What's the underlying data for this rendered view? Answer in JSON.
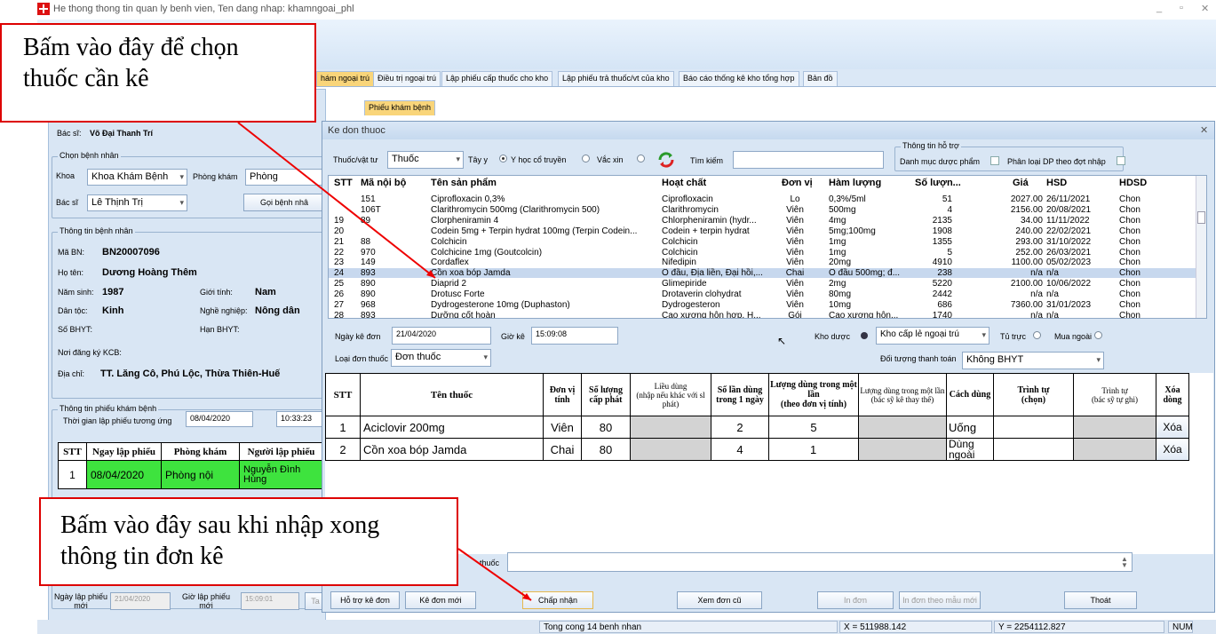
{
  "app": {
    "title": "He thong thong tin quan ly benh vien, Ten dang nhap: khamngoai_phl",
    "controls": [
      "_",
      "▫",
      "✕"
    ]
  },
  "main_tabs": [
    "hám ngoại trú",
    "Điều trị ngoại trú",
    "Lập phiếu cấp thuốc cho kho",
    "Lập phiếu trả thuốc/vt của kho",
    "Báo cáo thống kê kho tổng hợp",
    "Bản đồ"
  ],
  "sub_tab": "Phiếu khám bệnh",
  "left": {
    "bacsi_label": "Bác sĩ:",
    "bacsi": "Võ Đại Thanh Trí",
    "chon_bn": "Chọn bệnh nhân",
    "khoa_label": "Khoa",
    "khoa": "Khoa Khám Bệnh",
    "phongkham_label": "Phòng khám",
    "phongkham": "Phòng",
    "bacsi2_label": "Bác sĩ",
    "bacsi2": "Lê Thịnh Trị",
    "goi_btn": "Gọi bệnh nhâ",
    "ttbn": "Thông tin bệnh nhân",
    "mabn_label": "Mã BN:",
    "mabn": "BN20007096",
    "hoten_label": "Họ tên:",
    "hoten": "Dương Hoàng Thêm",
    "namsinh_label": "Năm sinh:",
    "namsinh": "1987",
    "gioitinh_label": "Giới tính:",
    "gioitinh": "Nam",
    "dantoc_label": "Dân tộc:",
    "dantoc": "Kinh",
    "nghe_label": "Nghề nghiệp:",
    "nghe": "Nông dân",
    "bhyt_label": "Số BHYT:",
    "hanbhyt_label": "Hạn BHYT:",
    "kcb_label": "Nơi đăng ký KCB:",
    "diachi_label": "Địa chỉ:",
    "diachi": "TT. Lăng Cô, Phú Lộc, Thừa Thiên-Huế",
    "ttpk": "Thông tin phiếu khám bệnh",
    "thoigian_label": "Thời gian lập phiếu tương ứng",
    "thoigian_date": "08/04/2020",
    "thoigian_time": "10:33:23",
    "grid_headers": [
      "STT",
      "Ngay lập phiếu",
      "Phòng khám",
      "Người lập phiếu"
    ],
    "grid_row": [
      "1",
      "08/04/2020",
      "Phòng nội",
      "Nguyễn Đình Hùng"
    ],
    "ngaylap_label": "Ngày lập phiếu mới",
    "ngaylap": "21/04/2020",
    "giolap_label": "Giờ lập phiếu mới",
    "giolap": "15:09:01",
    "ta": "Ta"
  },
  "dialog": {
    "title": "Ke don thuoc",
    "close": "✕",
    "loai_label": "Thuốc/vật tư",
    "loai": "Thuốc",
    "r1": "Tây y",
    "r2": "Y học cổ truyền",
    "r3": "Vắc xin",
    "timkiem_label": "Tìm kiếm",
    "hotro_title": "Thông tin hỗ trợ",
    "dmdp": "Danh mục dược phẩm",
    "phanloai": "Phân loại DP theo đợt nhập",
    "plist_headers": [
      "STT",
      "Mã nội bộ",
      "Tên sản phẩm",
      "Hoạt chất",
      "Đơn vị",
      "Hàm lượng",
      "Số lượn...",
      "Giá",
      "HSD",
      "HDSD"
    ],
    "plist_rows": [
      [
        "",
        "151",
        "Ciprofloxacin 0,3%",
        "Ciprofloxacin",
        "Lo",
        "0,3%/5ml",
        "51",
        "2027.00",
        "26/11/2021",
        "Chon"
      ],
      [
        "",
        "106T",
        "Clarithromycin 500mg (Clarithromycin 500)",
        "Clarithromycin",
        "Viên",
        "500mg",
        "4",
        "2156.00",
        "20/08/2021",
        "Chon"
      ],
      [
        "19",
        "89",
        "Clorpheniramin 4",
        "Chlorpheniramin (hydr...",
        "Viên",
        "4mg",
        "2135",
        "34.00",
        "11/11/2022",
        "Chon"
      ],
      [
        "20",
        "",
        "Codein 5mg + Terpin hydrat 100mg (Terpin Codein...",
        "Codein + terpin hydrat",
        "Viên",
        "5mg;100mg",
        "1908",
        "240.00",
        "22/02/2021",
        "Chon"
      ],
      [
        "21",
        "88",
        "Colchicin",
        "Colchicin",
        "Viên",
        "1mg",
        "1355",
        "293.00",
        "31/10/2022",
        "Chon"
      ],
      [
        "22",
        "970",
        "Colchicine 1mg (Goutcolcin)",
        "Colchicin",
        "Viên",
        "1mg",
        "5",
        "252.00",
        "26/03/2021",
        "Chon"
      ],
      [
        "23",
        "149",
        "Cordaflex",
        "Nifedipin",
        "Viên",
        "20mg",
        "4910",
        "1100.00",
        "05/02/2023",
        "Chon"
      ],
      [
        "24",
        "893",
        "Cồn xoa bóp Jamda",
        "Ô đầu, Địa liền, Đại hồi,...",
        "Chai",
        "Ô đầu 500mg; đ...",
        "238",
        "n/a",
        "n/a",
        "Chon"
      ],
      [
        "25",
        "890",
        "Diaprid 2",
        "Glimepiride",
        "Viên",
        "2mg",
        "5220",
        "2100.00",
        "10/06/2022",
        "Chon"
      ],
      [
        "26",
        "890",
        "Drotusc Forte",
        "Drotaverin clohydrat",
        "Viên",
        "80mg",
        "2442",
        "n/a",
        "n/a",
        "Chon"
      ],
      [
        "27",
        "968",
        "Dydrogesterone 10mg (Duphaston)",
        "Dydrogesteron",
        "Viên",
        "10mg",
        "686",
        "7360.00",
        "31/01/2023",
        "Chon"
      ],
      [
        "28",
        "893",
        "Dưỡng cốt hoàn",
        "Cao xương hỗn hợp, H...",
        "Gói",
        "Cao xương hỗn...",
        "1740",
        "n/a",
        "n/a",
        "Chon"
      ]
    ],
    "ngaykedon_label": "Ngày kê đơn",
    "ngaykedon": "21/04/2020",
    "giokedon_label": "Giờ kê",
    "giokedon": "15:09:08",
    "khoduoc_label": "Kho dược",
    "khoduoc": "Kho cấp lẻ ngoại trú",
    "tutruc": "Tủ trực",
    "muangoai": "Mua ngoài",
    "loaidon_label": "Loại đơn thuốc",
    "loaidon": "Đơn thuốc",
    "doituong_label": "Đối tượng thanh toán",
    "doituong": "Không BHYT",
    "rx_headers": [
      "STT",
      "Tên thuốc",
      "Đơn vị tính",
      "Số lượng cấp phát",
      "Liều dùng",
      "Số lần dùng trong 1 ngày",
      "Lượng dùng trong một lần",
      "Lượng dùng trong một lần",
      "Cách dùng",
      "Trình tự",
      "Trình tự",
      "Xóa dòng"
    ],
    "rx_subs": [
      "(nhập nếu khác với sl phát)",
      "(theo đơn vị tính)",
      "(bác sỹ kê thay thế)",
      "(chọn)",
      "(bác sỹ tự ghi)"
    ],
    "rx_rows": [
      [
        "1",
        "Aciclovir 200mg",
        "Viên",
        "80",
        "",
        "2",
        "5",
        "",
        "Uống",
        "",
        "",
        "Xóa"
      ],
      [
        "2",
        "Cồn xoa bóp Jamda",
        "Chai",
        "80",
        "",
        "4",
        "1",
        "",
        "Dùng ngoài",
        "",
        "",
        "Xóa"
      ]
    ],
    "loidan_label": "thuốc",
    "buttons": [
      "Hỗ trợ kê đơn",
      "Kê đơn mới",
      "Chấp nhận",
      "Xem đơn cũ",
      "In đơn",
      "In đơn theo mẫu mới",
      "Thoát"
    ]
  },
  "status": {
    "total": "Tong cong 14 benh nhan",
    "x": "X = 511988.142",
    "y": "Y = 2254112.827",
    "num": "NUM"
  },
  "callouts": {
    "top": "Bấm vào đây để chọn thuốc cần kê",
    "bottom": "Bấm vào đây sau khi nhập xong thông tin đơn kê"
  }
}
